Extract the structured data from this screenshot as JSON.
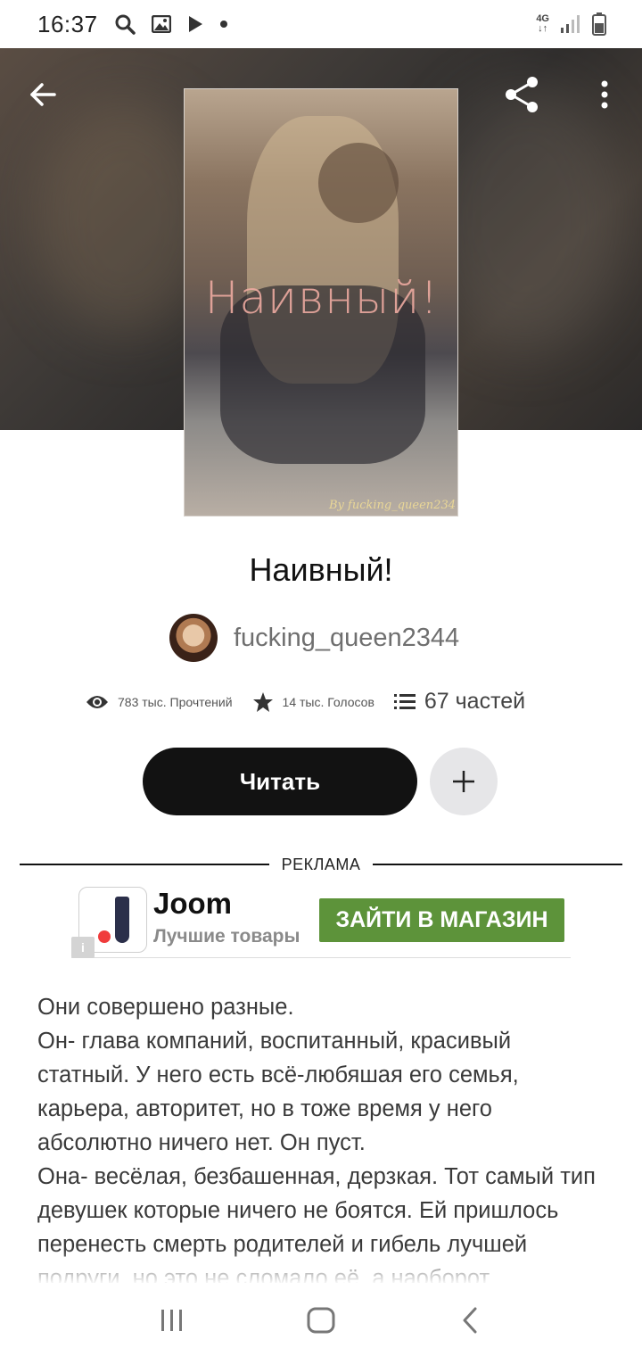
{
  "status_bar": {
    "time": "16:37",
    "icons": [
      "search-icon",
      "gallery-icon",
      "play-icon",
      "dot-icon"
    ],
    "network": "4G",
    "signal": "signal-bars-icon",
    "battery": "battery-icon"
  },
  "header": {
    "back_icon": "arrow-left-icon",
    "share_icon": "share-icon",
    "menu_icon": "more-vertical-icon"
  },
  "cover": {
    "title": "Наивный!",
    "signature": "By fucking_queen234"
  },
  "story": {
    "title": "Наивный!",
    "author": "fucking_queen2344"
  },
  "stats": {
    "reads": "783 тыс. Прочтений",
    "votes": "14 тыс. Голосов",
    "parts": "67 частей"
  },
  "actions": {
    "read_label": "Читать",
    "add_icon": "plus-icon"
  },
  "ad": {
    "label": "РЕКЛАМА",
    "brand": "Joom",
    "tagline": "Лучшие товары",
    "cta": "ЗАЙТИ В МАГАЗИН",
    "info_icon": "info-icon"
  },
  "description": {
    "lines": [
      "Они совершено разные.",
      "Он- глава компаний, воспитанный, красивый статный. У него есть всё-любяшая его семья, карьера, авторитет, но в тоже время у него абсолютно ничего нет. Он пуст.",
      "Она- весёлая, безбашенная, дерзкая. Тот самый тип девушек которые ничего не боятся. Ей пришлось перенесть смерть родителей и гибель лучшей подруги, но это не сломало её, а наоборот"
    ]
  },
  "nav_bar": {
    "recents_icon": "recents-icon",
    "home_icon": "home-icon",
    "back_icon": "back-icon"
  }
}
